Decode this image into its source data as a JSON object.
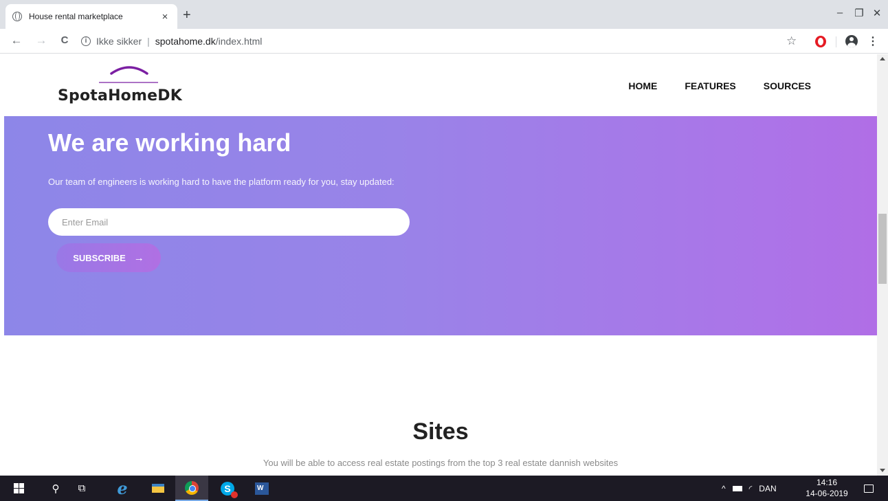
{
  "browser": {
    "tab_title": "House rental marketplace",
    "tab_close": "×",
    "new_tab": "+",
    "window_controls": {
      "minimize": "–",
      "restore": "❐",
      "close": "✕"
    },
    "nav": {
      "back": "←",
      "forward": "→",
      "reload": "C"
    },
    "address": {
      "security_label": "Ikke sikker",
      "separator": "|",
      "domain": "spotahome.dk",
      "path": "/index.html"
    },
    "bookmark_star": "☆",
    "menu": "⋮"
  },
  "site": {
    "logo_text": "SpotaHomeDK",
    "logo_color": "#7b1fa2",
    "nav": [
      {
        "label": "HOME"
      },
      {
        "label": "FEATURES"
      },
      {
        "label": "SOURCES"
      }
    ],
    "hero": {
      "title": "We are working hard",
      "text": "Our team of engineers is working hard to have the platform ready for you, stay updated:",
      "email_placeholder": "Enter Email",
      "subscribe_label": "SUBSCRIBE",
      "subscribe_arrow": "→",
      "gradient_start": "#8d86e8",
      "gradient_end": "#b06ee6"
    },
    "sites": {
      "title": "Sites",
      "text": "You will be able to access real estate postings from the top 3 real estate dannish websites"
    }
  },
  "taskbar": {
    "search_glyph": "⚲",
    "taskview_glyph": "⧉",
    "ie_glyph": "e",
    "skype_glyph": "S",
    "word_glyph": "W",
    "tray": {
      "chevron": "^",
      "wifi": "◜",
      "language": "DAN"
    },
    "clock": {
      "time": "14:16",
      "date": "14-06-2019"
    }
  }
}
